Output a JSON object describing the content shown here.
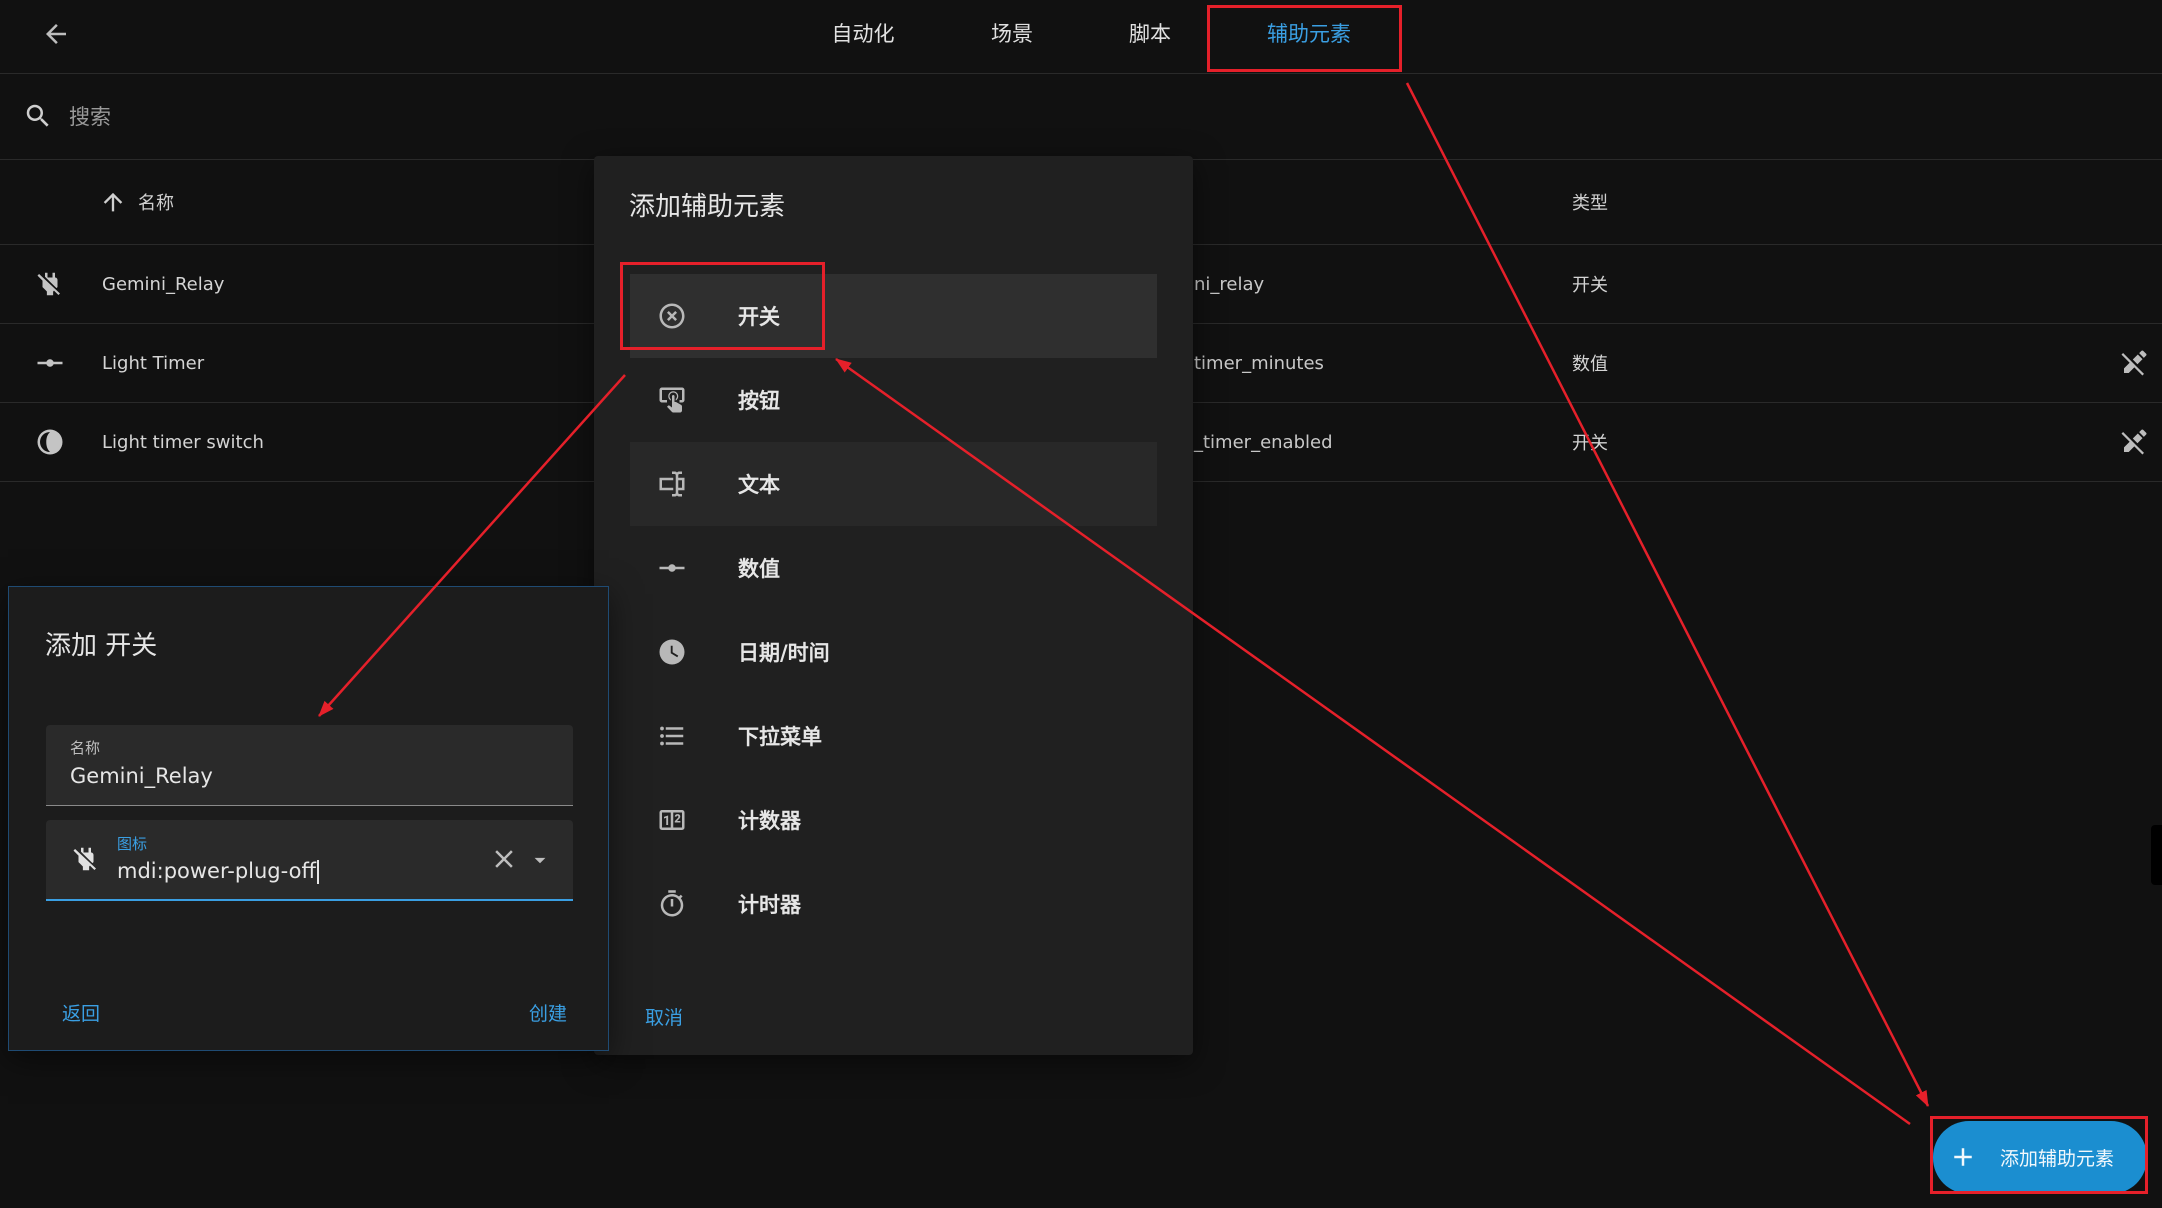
{
  "topbar": {
    "tabs": [
      {
        "label": "自动化"
      },
      {
        "label": "场景"
      },
      {
        "label": "脚本"
      },
      {
        "label": "辅助元素",
        "active": true
      }
    ],
    "back_icon": "arrow-left-icon"
  },
  "search": {
    "placeholder": "搜索",
    "icon": "magnify-icon"
  },
  "table": {
    "headers": {
      "name": "名称",
      "type": "类型"
    },
    "rows": [
      {
        "icon": "power-plug-off-icon",
        "name": "Gemini_Relay",
        "entity": "ni_relay",
        "type": "开关"
      },
      {
        "icon": "ray-vertex-icon",
        "name": "Light Timer",
        "entity": "timer_minutes",
        "type": "数值",
        "action_icon": "pencil-off-icon"
      },
      {
        "icon": "circle-half-icon",
        "name": "Light timer switch",
        "entity": "_timer_enabled",
        "type": "开关",
        "action_icon": "pencil-off-icon"
      }
    ]
  },
  "helper_dialog": {
    "title": "添加辅助元素",
    "items": [
      {
        "label": "开关",
        "icon": "close-circle-outline-icon"
      },
      {
        "label": "按钮",
        "icon": "gesture-tap-button-icon"
      },
      {
        "label": "文本",
        "icon": "form-textbox-icon"
      },
      {
        "label": "数值",
        "icon": "ray-vertex-icon"
      },
      {
        "label": "日期/时间",
        "icon": "clock-icon"
      },
      {
        "label": "下拉菜单",
        "icon": "format-list-bulleted-icon"
      },
      {
        "label": "计数器",
        "icon": "counter-icon"
      },
      {
        "label": "计时器",
        "icon": "timer-outline-icon"
      }
    ],
    "cancel": "取消"
  },
  "add_dialog": {
    "title": "添加 开关",
    "name_field": {
      "label": "名称",
      "value": "Gemini_Relay"
    },
    "icon_field": {
      "label": "图标",
      "value": "mdi:power-plug-off",
      "icon": "power-plug-off-icon"
    },
    "back": "返回",
    "create": "创建"
  },
  "fab": {
    "label": "添加辅助元素",
    "icon": "plus-icon"
  },
  "colors": {
    "background": "#111111",
    "accent": "#3a9fe3",
    "fab": "#1b8ed0",
    "annotation": "#e5202a"
  }
}
